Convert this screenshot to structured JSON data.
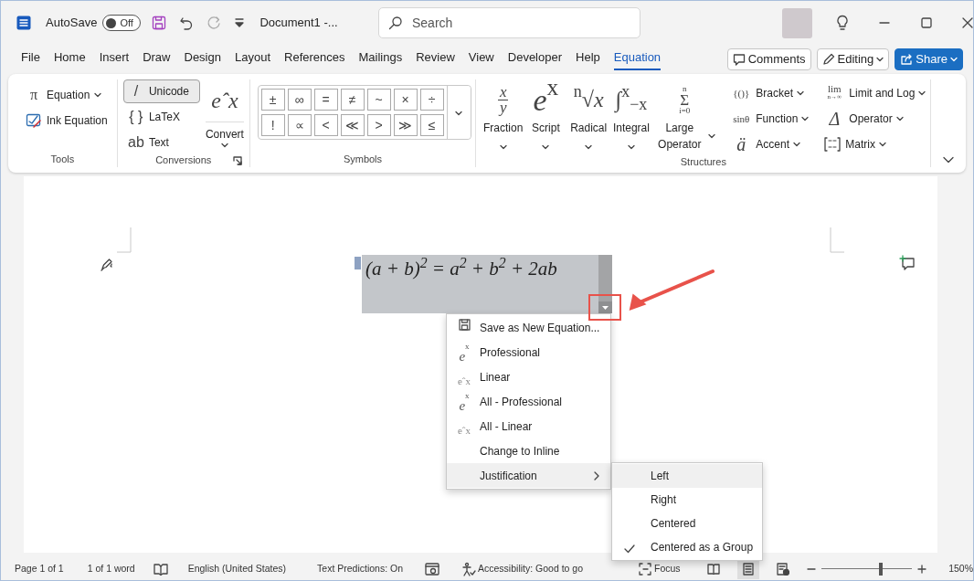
{
  "title_bar": {
    "autosave_label": "AutoSave",
    "autosave": {
      "on": false,
      "label": "Off"
    },
    "quick_access": [
      {
        "kind": "save",
        "disabled": false
      },
      {
        "kind": "undo",
        "disabled": false
      },
      {
        "kind": "redo",
        "disabled": true
      },
      {
        "kind": "customize",
        "disabled": false
      }
    ],
    "document_title": "Document1  -...",
    "search": {
      "placeholder": "Search"
    }
  },
  "tabs": [
    {
      "label": "File",
      "selected": false
    },
    {
      "label": "Home",
      "selected": false
    },
    {
      "label": "Insert",
      "selected": false
    },
    {
      "label": "Draw",
      "selected": false
    },
    {
      "label": "Design",
      "selected": false
    },
    {
      "label": "Layout",
      "selected": false
    },
    {
      "label": "References",
      "selected": false
    },
    {
      "label": "Mailings",
      "selected": false
    },
    {
      "label": "Review",
      "selected": false
    },
    {
      "label": "View",
      "selected": false
    },
    {
      "label": "Developer",
      "selected": false
    },
    {
      "label": "Help",
      "selected": false
    },
    {
      "label": "Equation",
      "selected": true
    }
  ],
  "header_buttons": [
    {
      "kind": "comments",
      "label": "Comments"
    },
    {
      "kind": "editing",
      "label": "Editing"
    },
    {
      "kind": "share",
      "label": "Share"
    }
  ],
  "ribbon": {
    "tools": {
      "label": "Tools",
      "items": [
        {
          "kind": "glyph",
          "icon": "π",
          "label": "Equation",
          "dropdown": true
        },
        {
          "kind": "ink",
          "label": "Ink Equation",
          "dropdown": false
        }
      ]
    },
    "conversions": {
      "label": "Conversions",
      "items": [
        {
          "icon": "/",
          "label": "Unicode",
          "selected": true
        },
        {
          "icon": "{ }",
          "label": "LaTeX",
          "selected": false
        },
        {
          "icon": "ab",
          "label": "Text",
          "selected": false
        }
      ],
      "convert": {
        "icon": "eˆx",
        "label": "Convert"
      }
    },
    "symbols": {
      "label": "Symbols",
      "items": [
        "±",
        "∞",
        "=",
        "≠",
        "~",
        "×",
        "÷",
        "!",
        "∝",
        "<",
        "≪",
        ">",
        "≫",
        "≤"
      ]
    },
    "structures": {
      "label": "Structures",
      "large": [
        {
          "kind": "fraction",
          "top": "x",
          "bottom": "y",
          "label": "Fraction"
        },
        {
          "kind": "inline",
          "icon": "*e*$^{x}$",
          "label": "Script"
        },
        {
          "kind": "inline",
          "icon": "$^{n}$√*x*",
          "label": "Radical"
        },
        {
          "kind": "inline",
          "icon": "∫$^{x}$$_{−x}$",
          "label": "Integral"
        },
        {
          "kind": "limits",
          "top": "n",
          "main": "Σ",
          "bottom": "i=0",
          "label": "Large Operator"
        }
      ],
      "small": [
        {
          "kind": "glyph",
          "icon": "{()}",
          "label": "Bracket"
        },
        {
          "kind": "glyph",
          "icon": "sinθ",
          "label": "Function"
        },
        {
          "kind": "glyph",
          "icon": "ä",
          "label": "Accent"
        },
        {
          "kind": "lim",
          "icon": "lim",
          "sub": "n→∞",
          "label": "Limit and Log"
        },
        {
          "kind": "glyph",
          "icon": "Δ",
          "label": "Operator"
        },
        {
          "kind": "matrix",
          "label": "Matrix"
        }
      ]
    }
  },
  "equation": {
    "text": "(a + b)$^{2}$ = a$^{2}$ + b$^{2}$ + 2ab",
    "selected": true
  },
  "context_menu": [
    {
      "kind": "save",
      "label": "Save as New Equation...",
      "selected": false
    },
    {
      "kind": "professional",
      "icon": "*e*$^{x}$",
      "label": "Professional",
      "selected": false
    },
    {
      "kind": "linear",
      "icon": "eˆx",
      "label": "Linear",
      "selected": false
    },
    {
      "kind": "professional",
      "icon": "*e*$^{x}$",
      "label": "All - Professional",
      "selected": false
    },
    {
      "kind": "linear",
      "icon": "eˆx",
      "label": "All - Linear",
      "selected": false
    },
    {
      "kind": "plain",
      "label": "Change to Inline",
      "selected": false
    },
    {
      "kind": "submenu",
      "label": "Justification",
      "selected": true
    }
  ],
  "justification_menu": [
    {
      "label": "Left",
      "selected": true,
      "checked": false
    },
    {
      "label": "Right",
      "selected": false,
      "checked": false
    },
    {
      "label": "Centered",
      "selected": false,
      "checked": false
    },
    {
      "label": "Centered as a Group",
      "selected": false,
      "checked": true
    }
  ],
  "status_bar": {
    "page": "Page 1 of 1",
    "words": "1 of 1 word",
    "language": "English (United States)",
    "text_predictions": "Text Predictions: On",
    "accessibility": "Accessibility: Good to go",
    "focus": "Focus",
    "views": [
      {
        "kind": "read",
        "selected": false
      },
      {
        "kind": "print",
        "selected": true
      },
      {
        "kind": "web",
        "selected": false
      }
    ],
    "zoom": {
      "level": 0.66,
      "reading": "150%"
    }
  }
}
